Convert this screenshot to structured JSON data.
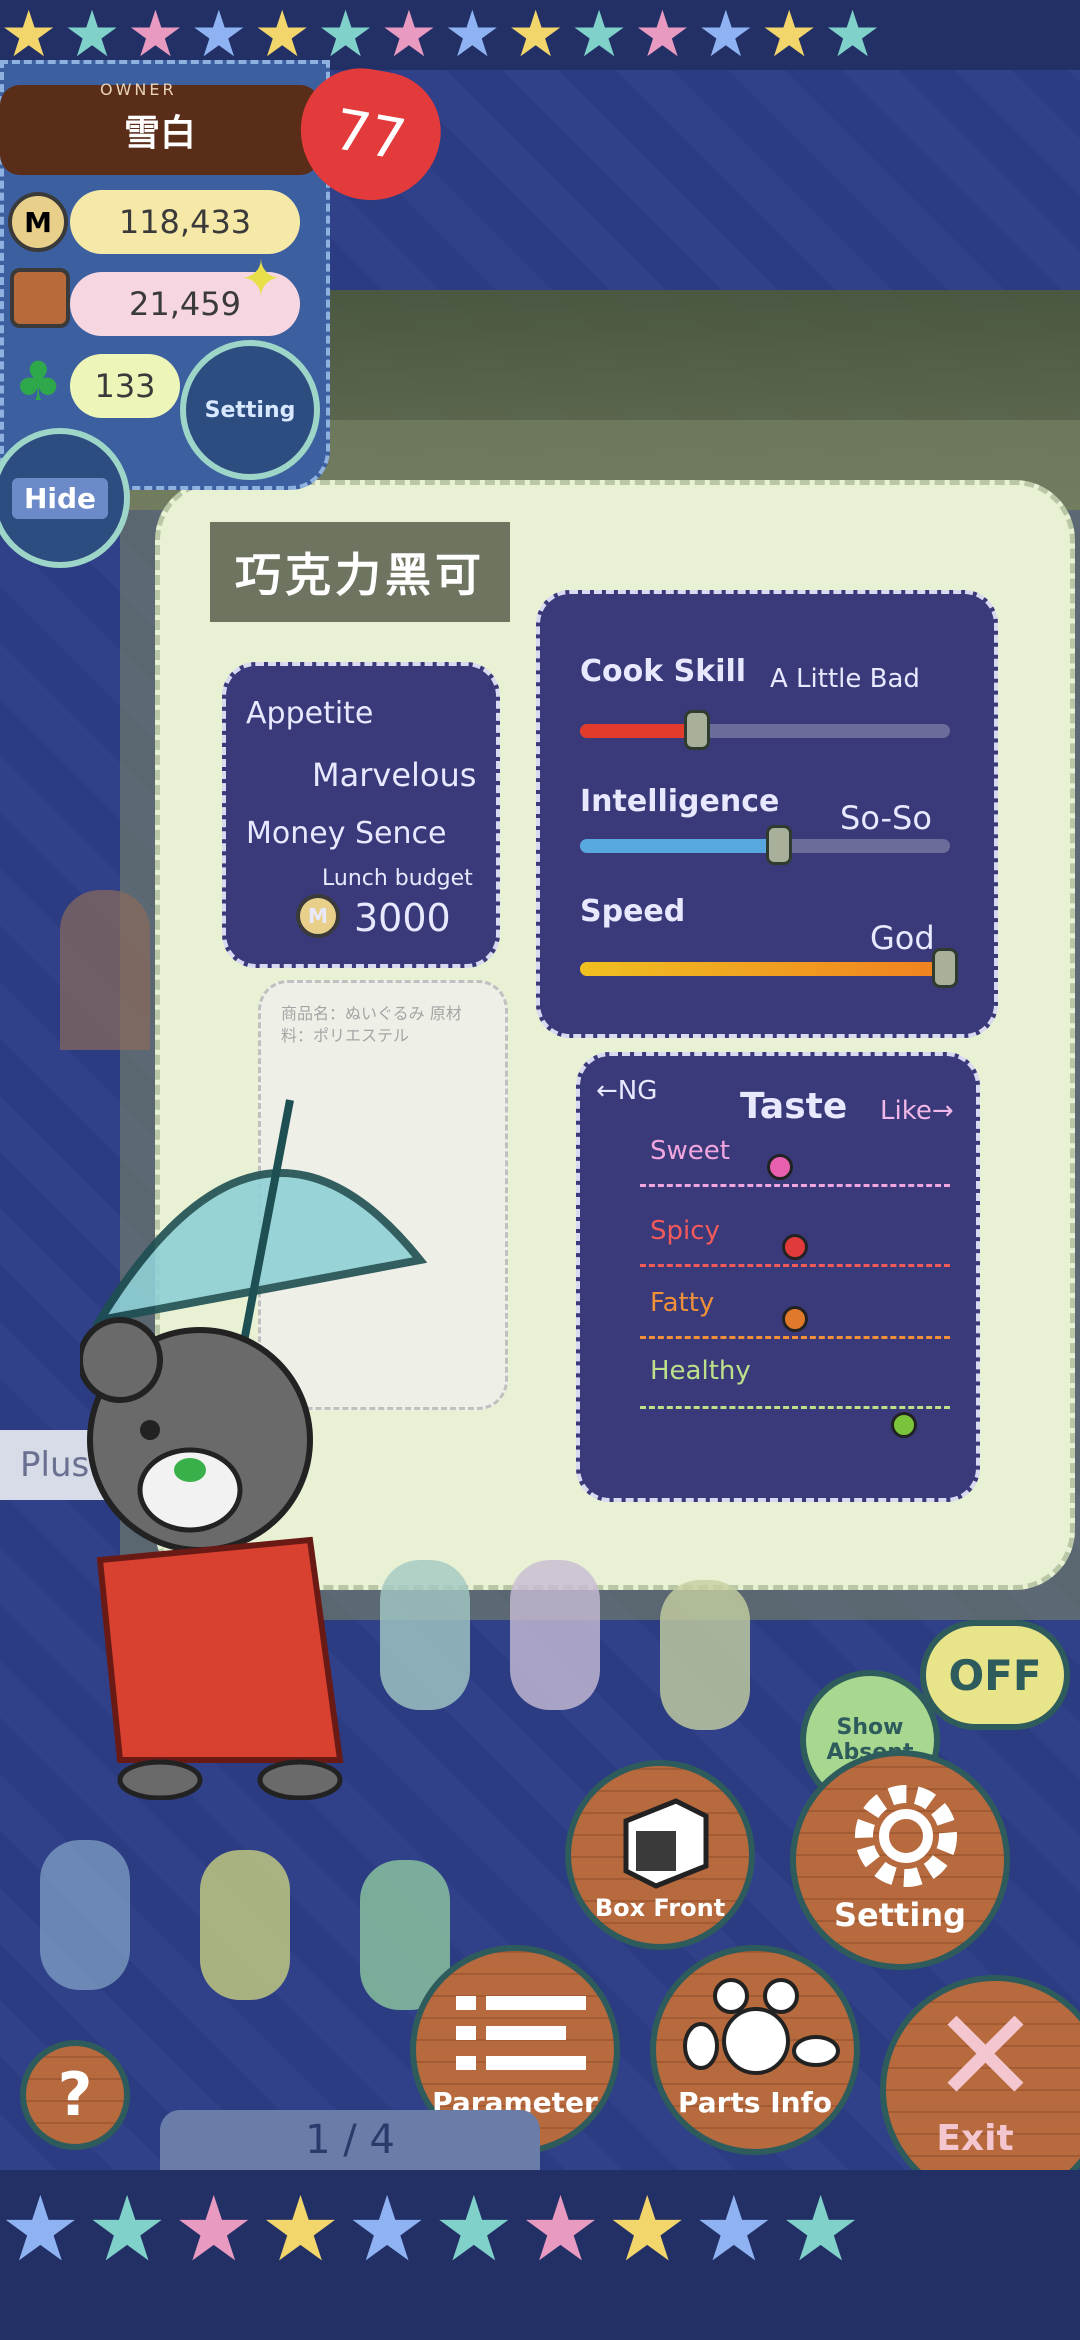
{
  "owner": {
    "tag": "OWNER",
    "name": "雪白",
    "hearts": "77",
    "money": "118,433",
    "materials": "21,459",
    "clovers": "133",
    "setting_label": "Setting",
    "hide_label": "Hide"
  },
  "plush": {
    "name": "巧克力黑可",
    "appetite_label": "Appetite",
    "appetite_value": "Marvelous",
    "money_label": "Money Sence",
    "budget_label": "Lunch budget",
    "budget_value": "3000",
    "cook_label": "Cook Skill",
    "cook_value": "A Little Bad",
    "cook_level": 0.33,
    "int_label": "Intelligence",
    "int_value": "So-So",
    "int_level": 0.55,
    "speed_label": "Speed",
    "speed_value": "God",
    "speed_level": 1.0,
    "taste_title": "Taste",
    "taste_ng": "←NG",
    "taste_like": "Like→",
    "tastes": [
      {
        "label": "Sweet",
        "level": 0.45,
        "color": "#e85fb0"
      },
      {
        "label": "Spicy",
        "level": 0.5,
        "color": "#e03a3a"
      },
      {
        "label": "Fatty",
        "level": 0.5,
        "color": "#e07a2a"
      },
      {
        "label": "Healthy",
        "level": 0.85,
        "color": "#7ac33a"
      }
    ],
    "note_text": "商品名：ぬいぐるみ 原材料：ポリエステル"
  },
  "side_label": "Plush",
  "page_indicator": "1 / 4",
  "actions": {
    "box_front": "Box Front",
    "setting": "Setting",
    "parameter": "Parameter",
    "parts_info": "Parts Info",
    "exit": "Exit",
    "help": "?",
    "off": "OFF",
    "show_absent": "Show Absent"
  }
}
